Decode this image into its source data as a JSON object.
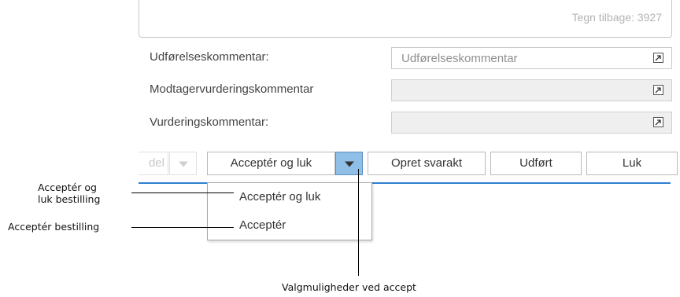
{
  "comment_box": {
    "chars_left": "Tegn tilbage: 3927"
  },
  "fields": [
    {
      "label": "Udførelseskommentar:",
      "placeholder": "Udførelseskommentar"
    },
    {
      "label": "Modtagervurderingskommentar",
      "placeholder": ""
    },
    {
      "label": "Vurderingskommentar:",
      "placeholder": ""
    }
  ],
  "toolbar": {
    "partial_button": "del",
    "accept_close": "Acceptér og luk",
    "create_reply": "Opret svarakt",
    "done": "Udført",
    "close": "Luk"
  },
  "dropdown": {
    "items": [
      "Acceptér og luk",
      "Acceptér"
    ]
  },
  "callouts": {
    "accept_close_line1": "Acceptér og",
    "accept_close_line2": "luk bestilling",
    "accept": "Acceptér bestilling",
    "options": "Valgmuligheder ved accept"
  }
}
